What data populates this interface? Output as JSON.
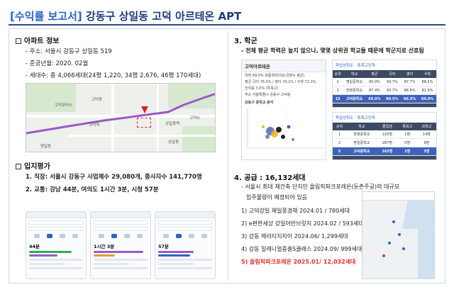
{
  "header": {
    "bracket_label": "[수익률 보고서]",
    "title": "강동구 상일동 고덕 아르테온 APT"
  },
  "apartment": {
    "heading": "아파트 정보",
    "address": "- 주소: 서울시 강동구 상일동 519",
    "completion": "- 준공년월: 2020. 02월",
    "households": "- 세대수: 총 4,066세대(24평 1,220, 34평 2,676, 46평 170세대)"
  },
  "map": {
    "labels": [
      "고덕역",
      "고덕동",
      "상일동역",
      "상일동",
      "명일동",
      "고덕모터스",
      "고덕IC"
    ]
  },
  "location": {
    "heading": "입지평가",
    "item1": "1. 직장: 서울시 강동구 사업체수 29,080개, 종사자수 141,770명",
    "item2": "2. 교통: 강남 44분, 여의도 1시간 3분, 시청 57분",
    "cards": [
      {
        "time": "44분"
      },
      {
        "time": "1시간 3분"
      },
      {
        "time": "57분"
      }
    ]
  },
  "school": {
    "heading": "3. 학군",
    "summary": "- 전체 평균 학력은 높지 않으나, 몇몇 상위권 학교들 때문에 학군지로 선호됨",
    "academy": {
      "title": "고덕아르테온",
      "lines": [
        "학력 69.0% 보통학력이상(국영수 평균)",
        "평균 국어 78.0% / 영어 79.1% / 수학 72.3%",
        "진학률 3.0% (특목고)",
        "주소 서울특별시 강동구 고덕동"
      ],
      "chart_caption": "강동구 중학교 분석"
    },
    "table1": {
      "tab": "학업성취도 · 특목고진학",
      "headers": [
        "순위",
        "학교",
        "평균",
        "국어",
        "영어",
        "수학"
      ],
      "rows": [
        [
          "1",
          "명일중학교",
          "90.0%",
          "93.7%",
          "87.7%",
          "88.5%"
        ],
        [
          "2",
          "한영중학교",
          "87.4%",
          "93.7%",
          "86.6%",
          "81.9%"
        ],
        [
          "15",
          "고덕중학교",
          "69.0%",
          "80.5%",
          "66.5%",
          "60.0%"
        ]
      ]
    },
    "table2": {
      "tab": "학업성취도 · 특목고진학",
      "headers": [
        "순위",
        "학교",
        "졸업생",
        "특목고",
        "과학고"
      ],
      "rows": [
        [
          "1",
          "한영중학교",
          "220명",
          "1명",
          "14명"
        ],
        [
          "2",
          "명일중학교",
          "287명",
          "0명",
          "9명"
        ],
        [
          "5",
          "고덕중학교",
          "165명",
          "2명",
          "3명"
        ]
      ]
    }
  },
  "supply": {
    "heading": "4. 공급 : 16,132세대",
    "desc1": "- 서울시 최대 재건축 단지인 올림픽파크포레온(둔촌주공)의 대규모",
    "desc2": "입주물량이 예정되어 있음",
    "items": [
      "1) 고덕강일 제일풍경채 2024.01 / 780세대",
      "2) e편한세상 강일어반브릿지 2024.02 / 593세대",
      "3) 강동 헤리티지자이 2024.06/ 1,299세대",
      "4) 강동 밀레니얼중흥S클래스 2024.09/ 999세대",
      "5) 올림픽파크포레온 2025.01/ 12,032세대"
    ]
  }
}
